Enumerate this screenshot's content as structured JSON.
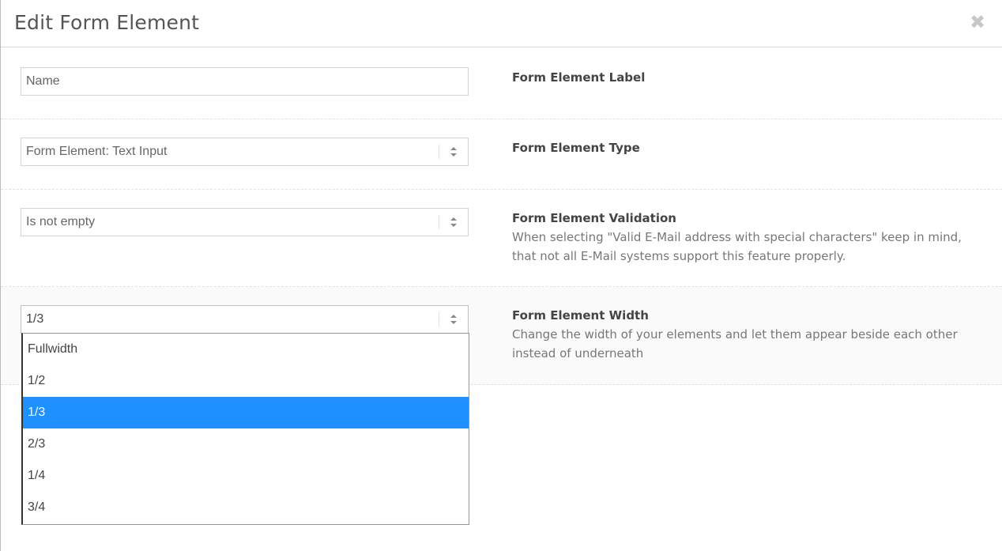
{
  "modal": {
    "title": "Edit Form Element",
    "close_glyph": "✖"
  },
  "rows": [
    {
      "field_value": "Name",
      "label": "Form Element Label",
      "description": ""
    },
    {
      "field_value": "Form Element: Text Input",
      "label": "Form Element Type",
      "description": ""
    },
    {
      "field_value": "Is not empty",
      "label": "Form Element Validation",
      "description": "When selecting \"Valid E-Mail address with special characters\" keep in mind, that not all E-Mail systems support this feature properly."
    },
    {
      "field_value": "1/3",
      "label": "Form Element Width",
      "description": "Change the width of your elements and let them appear beside each other instead of underneath"
    }
  ],
  "width_dropdown": {
    "options": [
      "Fullwidth",
      "1/2",
      "1/3",
      "2/3",
      "1/4",
      "3/4"
    ],
    "selected": "1/3"
  },
  "colors": {
    "selected_option_bg": "#1e90ff",
    "selected_option_text": "#ffffff"
  }
}
